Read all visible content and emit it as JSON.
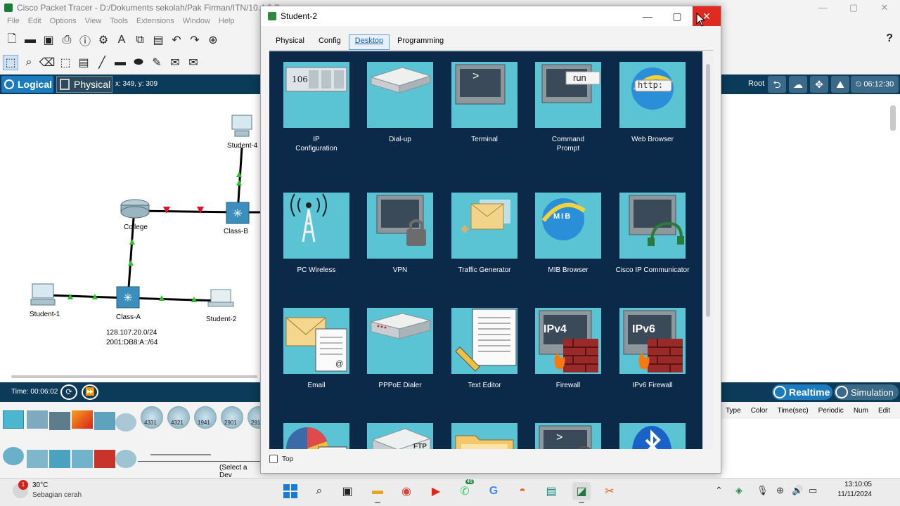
{
  "pt_window": {
    "title": "Cisco Packet Tracer - D:/Dokuments sekolah/Pak Firman/ITN/10.4.3 Pa",
    "menu": [
      "File",
      "Edit",
      "Options",
      "View",
      "Tools",
      "Extensions",
      "Window",
      "Help"
    ],
    "help_label": "?",
    "tabs": {
      "logical": "Logical",
      "physical": "Physical"
    },
    "coords": "x: 349, y: 309",
    "root_label": "Root",
    "clock_label": "06:12:30",
    "time_label": "Time: 00:06:02",
    "realtime_label": "Realtime",
    "simulation_label": "Simulation",
    "pdu_headers": [
      "Type",
      "Color",
      "Time(sec)",
      "Periodic",
      "Num",
      "Edit"
    ],
    "select_device_text": "(Select a Dev",
    "device_models": [
      "4331",
      "4321",
      "1941",
      "2901",
      "291"
    ]
  },
  "topology": {
    "nodes": [
      {
        "name": "Student-4"
      },
      {
        "name": "College"
      },
      {
        "name": "Class-B"
      },
      {
        "name": "Student-1"
      },
      {
        "name": "Class-A"
      },
      {
        "name": "Student-2"
      }
    ],
    "network_ip4": "128.107.20.0/24",
    "network_ip6": "2001:DB8:A::/64"
  },
  "dialog": {
    "title": "Student-2",
    "tabs": [
      "Physical",
      "Config",
      "Desktop",
      "Programming"
    ],
    "active_tab": "Desktop",
    "top_checkbox_label": "Top",
    "apps": [
      {
        "label": "IP\nConfiguration",
        "icon": "ip-configuration-icon",
        "glyph": "106"
      },
      {
        "label": "Dial-up",
        "icon": "dialup-icon"
      },
      {
        "label": "Terminal",
        "icon": "terminal-icon",
        "glyph": ">"
      },
      {
        "label": "Command\nPrompt",
        "icon": "command-prompt-icon",
        "glyph": "run"
      },
      {
        "label": "Web Browser",
        "icon": "web-browser-icon",
        "glyph": "http:"
      },
      {
        "label": "PC Wireless",
        "icon": "pc-wireless-icon"
      },
      {
        "label": "VPN",
        "icon": "vpn-icon"
      },
      {
        "label": "Traffic Generator",
        "icon": "traffic-generator-icon"
      },
      {
        "label": "MIB Browser",
        "icon": "mib-browser-icon",
        "glyph": "MIB"
      },
      {
        "label": "Cisco IP Communicator",
        "icon": "ip-communicator-icon"
      },
      {
        "label": "Email",
        "icon": "email-icon",
        "glyph": "@"
      },
      {
        "label": "PPPoE Dialer",
        "icon": "pppoe-dialer-icon"
      },
      {
        "label": "Text Editor",
        "icon": "text-editor-icon"
      },
      {
        "label": "Firewall",
        "icon": "firewall-icon",
        "glyph": "IPv4"
      },
      {
        "label": "IPv6 Firewall",
        "icon": "ipv6-firewall-icon",
        "glyph": "IPv6"
      },
      {
        "label": "",
        "icon": "netflow-collector-icon"
      },
      {
        "label": "",
        "icon": "tftp-icon",
        "glyph": "FTP"
      },
      {
        "label": "",
        "icon": "file-manager-icon"
      },
      {
        "label": "",
        "icon": "terminal-2-icon",
        "glyph": ">"
      },
      {
        "label": "",
        "icon": "bluetooth-icon"
      }
    ]
  },
  "taskbar": {
    "weather_temp": "30°C",
    "weather_desc": "Sebagian cerah",
    "weather_badge": "1",
    "whatsapp_badge": "46",
    "time": "13:10:05",
    "date": "11/11/2024"
  },
  "colors": {
    "desktop_bg": "#0b2a4a",
    "tile_bg": "#5ac3d4",
    "pt_bar": "#0b3b58",
    "accent": "#1b7bbd",
    "close_red": "#e02a20"
  }
}
